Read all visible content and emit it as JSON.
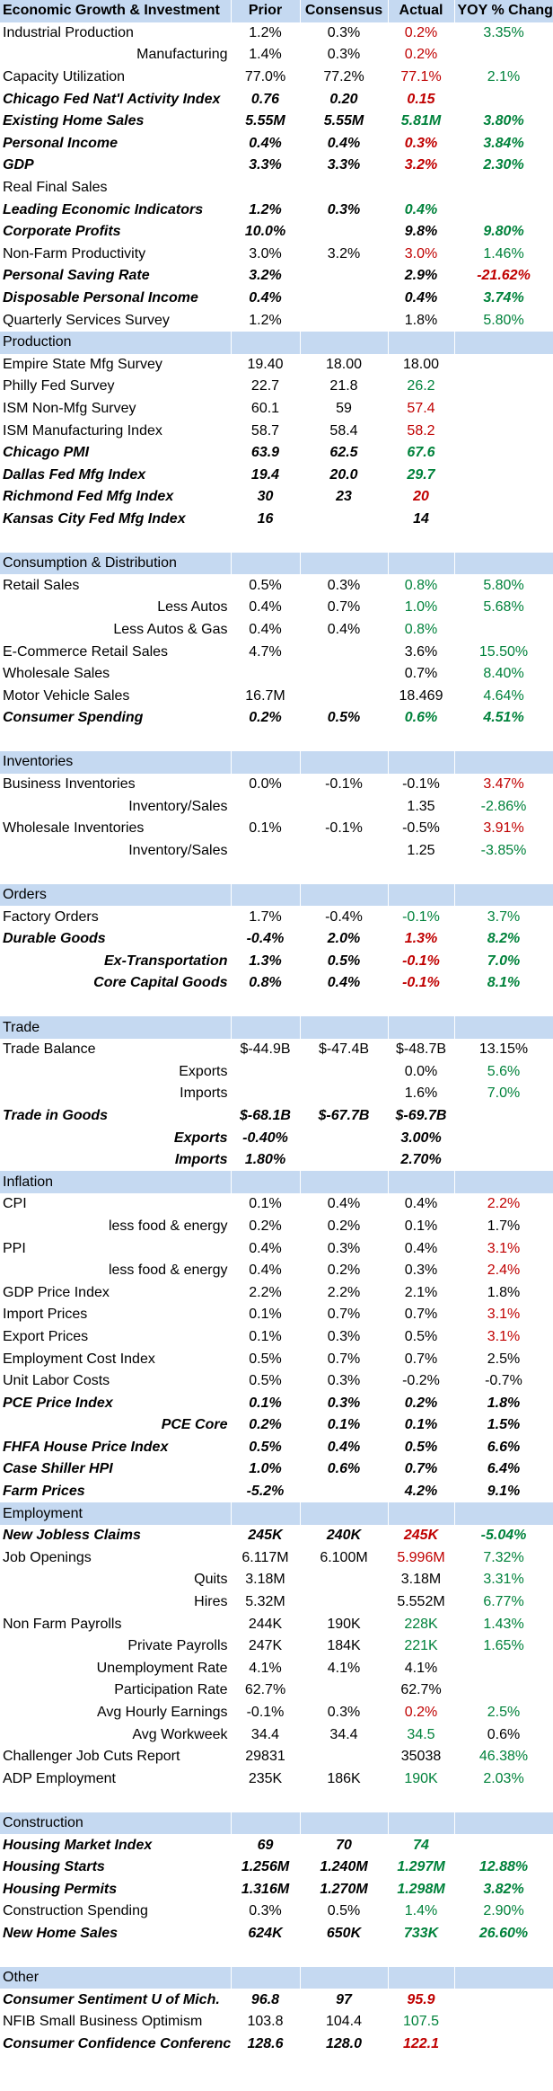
{
  "headers": [
    "Economic Growth & Investment",
    "Prior",
    "Consensus",
    "Actual",
    "YOY % Change"
  ],
  "rows": [
    {
      "label": "Industrial Production",
      "prior": "1.2%",
      "cons": "0.3%",
      "actual": "0.2%",
      "actual_color": "red",
      "yoy": "3.35%",
      "yoy_color": "green"
    },
    {
      "label": "Manufacturing",
      "align": "right",
      "prior": "1.4%",
      "cons": "0.3%",
      "actual": "0.2%",
      "actual_color": "red",
      "yoy": ""
    },
    {
      "label": "Capacity Utilization",
      "prior": "77.0%",
      "cons": "77.2%",
      "actual": "77.1%",
      "actual_color": "red",
      "yoy": "2.1%",
      "yoy_color": "green"
    },
    {
      "label": "Chicago Fed Nat'l Activity Index",
      "bi": true,
      "prior": "0.76",
      "cons": "0.20",
      "actual": "0.15",
      "actual_color": "red",
      "yoy": ""
    },
    {
      "label": "Existing Home Sales",
      "bi": true,
      "prior": "5.55M",
      "cons": "5.55M",
      "actual": "5.81M",
      "actual_color": "green",
      "yoy": "3.80%",
      "yoy_color": "green"
    },
    {
      "label": "Personal Income",
      "bi": true,
      "prior": "0.4%",
      "cons": "0.4%",
      "actual": "0.3%",
      "actual_color": "red",
      "yoy": "3.84%",
      "yoy_color": "green"
    },
    {
      "label": "GDP",
      "bi": true,
      "prior": "3.3%",
      "cons": "3.3%",
      "actual": "3.2%",
      "actual_color": "red",
      "yoy": "2.30%",
      "yoy_color": "green"
    },
    {
      "label": "Real Final Sales",
      "prior": "",
      "cons": "",
      "actual": "",
      "yoy": ""
    },
    {
      "label": "Leading Economic Indicators",
      "bi": true,
      "prior": "1.2%",
      "cons": "0.3%",
      "actual": "0.4%",
      "actual_color": "green",
      "yoy": ""
    },
    {
      "label": "Corporate Profits",
      "bi": true,
      "prior": "10.0%",
      "cons": "",
      "actual": "9.8%",
      "yoy": "9.80%",
      "yoy_color": "green"
    },
    {
      "label": "Non-Farm Productivity",
      "prior": "3.0%",
      "cons": "3.2%",
      "actual": "3.0%",
      "actual_color": "red",
      "yoy": "1.46%",
      "yoy_color": "green"
    },
    {
      "label": "Personal Saving Rate",
      "bi": true,
      "prior": "3.2%",
      "cons": "",
      "actual": "2.9%",
      "yoy": "-21.62%",
      "yoy_color": "red"
    },
    {
      "label": "Disposable Personal Income",
      "bi": true,
      "prior": "0.4%",
      "cons": "",
      "actual": "0.4%",
      "yoy": "3.74%",
      "yoy_color": "green"
    },
    {
      "label": "Quarterly Services Survey",
      "prior": "1.2%",
      "cons": "",
      "actual": "1.8%",
      "yoy": "5.80%",
      "yoy_color": "green"
    },
    {
      "section": "Production"
    },
    {
      "label": "Empire State Mfg Survey",
      "prior": "19.40",
      "cons": "18.00",
      "actual": "18.00",
      "yoy": ""
    },
    {
      "label": "Philly Fed Survey",
      "prior": "22.7",
      "cons": "21.8",
      "actual": "26.2",
      "actual_color": "green",
      "yoy": ""
    },
    {
      "label": "ISM Non-Mfg Survey",
      "prior": "60.1",
      "cons": "59",
      "actual": "57.4",
      "actual_color": "red",
      "yoy": ""
    },
    {
      "label": "ISM Manufacturing Index",
      "prior": "58.7",
      "cons": "58.4",
      "actual": "58.2",
      "actual_color": "red",
      "yoy": ""
    },
    {
      "label": "Chicago PMI",
      "bi": true,
      "prior": "63.9",
      "cons": "62.5",
      "actual": "67.6",
      "actual_color": "green",
      "yoy": ""
    },
    {
      "label": "Dallas Fed Mfg Index",
      "bi": true,
      "prior": "19.4",
      "cons": "20.0",
      "actual": "29.7",
      "actual_color": "green",
      "yoy": ""
    },
    {
      "label": "Richmond Fed Mfg Index",
      "bi": true,
      "prior": "30",
      "cons": "23",
      "actual": "20",
      "actual_color": "red",
      "yoy": ""
    },
    {
      "label": "Kansas City Fed Mfg Index",
      "bi": true,
      "prior": "16",
      "cons": "",
      "actual": "14",
      "yoy": ""
    },
    {
      "blank": true
    },
    {
      "section": "Consumption & Distribution"
    },
    {
      "label": "Retail Sales",
      "prior": "0.5%",
      "cons": "0.3%",
      "actual": "0.8%",
      "actual_color": "green",
      "yoy": "5.80%",
      "yoy_color": "green"
    },
    {
      "label": "Less Autos",
      "align": "right",
      "prior": "0.4%",
      "cons": "0.7%",
      "actual": "1.0%",
      "actual_color": "green",
      "yoy": "5.68%",
      "yoy_color": "green"
    },
    {
      "label": "Less Autos & Gas",
      "align": "right",
      "prior": "0.4%",
      "cons": "0.4%",
      "actual": "0.8%",
      "actual_color": "green",
      "yoy": ""
    },
    {
      "label": "E-Commerce Retail Sales",
      "prior": "4.7%",
      "cons": "",
      "actual": "3.6%",
      "yoy": "15.50%",
      "yoy_color": "green"
    },
    {
      "label": "Wholesale Sales",
      "prior": "",
      "cons": "",
      "actual": "0.7%",
      "yoy": "8.40%",
      "yoy_color": "green"
    },
    {
      "label": "Motor Vehicle Sales",
      "prior": "16.7M",
      "cons": "",
      "actual": "18.469",
      "yoy": "4.64%",
      "yoy_color": "green"
    },
    {
      "label": "Consumer Spending",
      "bi": true,
      "prior": "0.2%",
      "cons": "0.5%",
      "actual": "0.6%",
      "actual_color": "green",
      "yoy": "4.51%",
      "yoy_color": "green"
    },
    {
      "blank": true
    },
    {
      "section": "Inventories"
    },
    {
      "label": "Business Inventories",
      "prior": "0.0%",
      "cons": "-0.1%",
      "actual": "-0.1%",
      "yoy": "3.47%",
      "yoy_color": "red"
    },
    {
      "label": "Inventory/Sales",
      "align": "right",
      "prior": "",
      "cons": "",
      "actual": "1.35",
      "yoy": "-2.86%",
      "yoy_color": "green"
    },
    {
      "label": "Wholesale Inventories",
      "prior": "0.1%",
      "cons": "-0.1%",
      "actual": "-0.5%",
      "yoy": "3.91%",
      "yoy_color": "red"
    },
    {
      "label": "Inventory/Sales",
      "align": "right",
      "prior": "",
      "cons": "",
      "actual": "1.25",
      "yoy": "-3.85%",
      "yoy_color": "green"
    },
    {
      "blank": true
    },
    {
      "section": "Orders"
    },
    {
      "label": "Factory Orders",
      "prior": "1.7%",
      "cons": "-0.4%",
      "actual": "-0.1%",
      "actual_color": "green",
      "yoy": "3.7%",
      "yoy_color": "green"
    },
    {
      "label": "Durable Goods",
      "bi": true,
      "prior": "-0.4%",
      "cons": "2.0%",
      "actual": "1.3%",
      "actual_color": "red",
      "yoy": "8.2%",
      "yoy_color": "green"
    },
    {
      "label": "Ex-Transportation",
      "bi": true,
      "align": "right",
      "prior": "1.3%",
      "cons": "0.5%",
      "actual": "-0.1%",
      "actual_color": "red",
      "yoy": "7.0%",
      "yoy_color": "green"
    },
    {
      "label": "Core Capital Goods",
      "bi": true,
      "align": "right",
      "prior": "0.8%",
      "cons": "0.4%",
      "actual": "-0.1%",
      "actual_color": "red",
      "yoy": "8.1%",
      "yoy_color": "green"
    },
    {
      "blank": true
    },
    {
      "section": "Trade"
    },
    {
      "label": "Trade Balance",
      "prior": "$-44.9B",
      "cons": "$-47.4B",
      "actual": "$-48.7B",
      "yoy": "13.15%"
    },
    {
      "label": "Exports",
      "align": "right",
      "prior": "",
      "cons": "",
      "actual": "0.0%",
      "yoy": "5.6%",
      "yoy_color": "green"
    },
    {
      "label": "Imports",
      "align": "right",
      "prior": "",
      "cons": "",
      "actual": "1.6%",
      "yoy": "7.0%",
      "yoy_color": "green"
    },
    {
      "label": "Trade in Goods",
      "bi": true,
      "prior": "$-68.1B",
      "cons": "$-67.7B",
      "actual": "$-69.7B",
      "yoy": ""
    },
    {
      "label": "Exports",
      "bi": true,
      "align": "right",
      "prior": "-0.40%",
      "cons": "",
      "actual": "3.00%",
      "yoy": ""
    },
    {
      "label": "Imports",
      "bi": true,
      "align": "right",
      "prior": "1.80%",
      "cons": "",
      "actual": "2.70%",
      "yoy": ""
    },
    {
      "section": "Inflation"
    },
    {
      "label": "CPI",
      "prior": "0.1%",
      "cons": "0.4%",
      "actual": "0.4%",
      "yoy": "2.2%",
      "yoy_color": "red"
    },
    {
      "label": "less food & energy",
      "align": "right",
      "prior": "0.2%",
      "cons": "0.2%",
      "actual": "0.1%",
      "yoy": "1.7%"
    },
    {
      "label": "PPI",
      "prior": "0.4%",
      "cons": "0.3%",
      "actual": "0.4%",
      "yoy": "3.1%",
      "yoy_color": "red"
    },
    {
      "label": "less food & energy",
      "align": "right",
      "prior": "0.4%",
      "cons": "0.2%",
      "actual": "0.3%",
      "yoy": "2.4%",
      "yoy_color": "red"
    },
    {
      "label": "GDP Price Index",
      "prior": "2.2%",
      "cons": "2.2%",
      "actual": "2.1%",
      "yoy": "1.8%"
    },
    {
      "label": "Import Prices",
      "prior": "0.1%",
      "cons": "0.7%",
      "actual": "0.7%",
      "yoy": "3.1%",
      "yoy_color": "red"
    },
    {
      "label": "Export Prices",
      "prior": "0.1%",
      "cons": "0.3%",
      "actual": "0.5%",
      "yoy": "3.1%",
      "yoy_color": "red"
    },
    {
      "label": "Employment Cost Index",
      "prior": "0.5%",
      "cons": "0.7%",
      "actual": "0.7%",
      "yoy": "2.5%"
    },
    {
      "label": "Unit Labor Costs",
      "prior": "0.5%",
      "cons": "0.3%",
      "actual": "-0.2%",
      "yoy": "-0.7%"
    },
    {
      "label": "PCE Price Index",
      "bi": true,
      "prior": "0.1%",
      "cons": "0.3%",
      "actual": "0.2%",
      "yoy": "1.8%"
    },
    {
      "label": "PCE Core",
      "bi": true,
      "align": "right",
      "prior": "0.2%",
      "cons": "0.1%",
      "actual": "0.1%",
      "yoy": "1.5%"
    },
    {
      "label": "FHFA House Price Index",
      "bi": true,
      "prior": "0.5%",
      "cons": "0.4%",
      "actual": "0.5%",
      "yoy": "6.6%"
    },
    {
      "label": "Case Shiller HPI",
      "bi": true,
      "prior": "1.0%",
      "cons": "0.6%",
      "actual": "0.7%",
      "yoy": "6.4%"
    },
    {
      "label": "Farm Prices",
      "bi": true,
      "prior": "-5.2%",
      "cons": "",
      "actual": "4.2%",
      "yoy": "9.1%"
    },
    {
      "section": "Employment"
    },
    {
      "label": "New Jobless Claims",
      "bi": true,
      "prior": "245K",
      "cons": "240K",
      "actual": "245K",
      "actual_color": "red",
      "yoy": "-5.04%",
      "yoy_color": "green"
    },
    {
      "label": "Job Openings",
      "prior": "6.117M",
      "cons": "6.100M",
      "actual": "5.996M",
      "actual_color": "red",
      "yoy": "7.32%",
      "yoy_color": "green"
    },
    {
      "label": "Quits",
      "align": "right",
      "prior": "3.18M",
      "cons": "",
      "actual": "3.18M",
      "yoy": "3.31%",
      "yoy_color": "green"
    },
    {
      "label": "Hires",
      "align": "right",
      "prior": "5.32M",
      "cons": "",
      "actual": "5.552M",
      "yoy": "6.77%",
      "yoy_color": "green"
    },
    {
      "label": "Non Farm Payrolls",
      "prior": "244K",
      "cons": "190K",
      "actual": "228K",
      "actual_color": "green",
      "yoy": "1.43%",
      "yoy_color": "green"
    },
    {
      "label": "Private Payrolls",
      "align": "right",
      "prior": "247K",
      "cons": "184K",
      "actual": "221K",
      "actual_color": "green",
      "yoy": "1.65%",
      "yoy_color": "green"
    },
    {
      "label": "Unemployment Rate",
      "align": "right",
      "prior": "4.1%",
      "cons": "4.1%",
      "actual": "4.1%",
      "yoy": ""
    },
    {
      "label": "Participation Rate",
      "align": "right",
      "prior": "62.7%",
      "cons": "",
      "actual": "62.7%",
      "yoy": ""
    },
    {
      "label": "Avg Hourly Earnings",
      "align": "right",
      "prior": "-0.1%",
      "cons": "0.3%",
      "actual": "0.2%",
      "actual_color": "red",
      "yoy": "2.5%",
      "yoy_color": "green"
    },
    {
      "label": "Avg Workweek",
      "align": "right",
      "prior": "34.4",
      "cons": "34.4",
      "actual": "34.5",
      "actual_color": "green",
      "yoy": "0.6%"
    },
    {
      "label": "Challenger Job Cuts Report",
      "prior": "29831",
      "cons": "",
      "actual": "35038",
      "yoy": "46.38%",
      "yoy_color": "green"
    },
    {
      "label": "ADP Employment",
      "prior": "235K",
      "cons": "186K",
      "actual": "190K",
      "actual_color": "green",
      "yoy": "2.03%",
      "yoy_color": "green"
    },
    {
      "blank": true
    },
    {
      "section": "Construction"
    },
    {
      "label": "Housing Market Index",
      "bi": true,
      "prior": "69",
      "cons": "70",
      "actual": "74",
      "actual_color": "green",
      "yoy": ""
    },
    {
      "label": "Housing Starts",
      "bi": true,
      "prior": "1.256M",
      "cons": "1.240M",
      "actual": "1.297M",
      "actual_color": "green",
      "yoy": "12.88%",
      "yoy_color": "green"
    },
    {
      "label": "Housing Permits",
      "bi": true,
      "prior": "1.316M",
      "cons": "1.270M",
      "actual": "1.298M",
      "actual_color": "green",
      "yoy": "3.82%",
      "yoy_color": "green"
    },
    {
      "label": "Construction Spending",
      "prior": "0.3%",
      "cons": "0.5%",
      "actual": "1.4%",
      "actual_color": "green",
      "yoy": "2.90%",
      "yoy_color": "green"
    },
    {
      "label": "New Home Sales",
      "bi": true,
      "prior": "624K",
      "cons": "650K",
      "actual": "733K",
      "actual_color": "green",
      "yoy": "26.60%",
      "yoy_color": "green"
    },
    {
      "blank": true
    },
    {
      "section": "Other"
    },
    {
      "label": "Consumer Sentiment U of Mich.",
      "bi": true,
      "prior": "96.8",
      "cons": "97",
      "actual": "95.9",
      "actual_color": "red",
      "yoy": ""
    },
    {
      "label": "NFIB Small Business Optimism",
      "prior": "103.8",
      "cons": "104.4",
      "actual": "107.5",
      "actual_color": "green",
      "yoy": ""
    },
    {
      "label": "Consumer Confidence Conference",
      "bi": true,
      "prior": "128.6",
      "cons": "128.0",
      "actual": "122.1",
      "actual_color": "red",
      "yoy": ""
    }
  ]
}
